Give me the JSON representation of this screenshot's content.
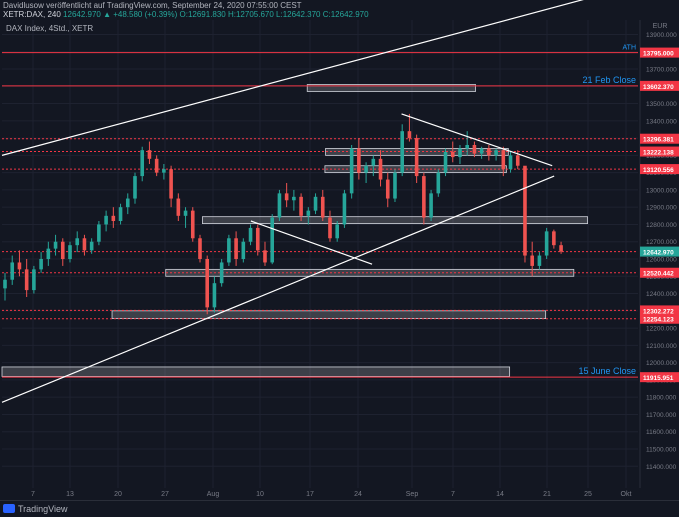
{
  "header": {
    "line1": "Davidlusow veröffentlicht auf TradingView.com, September 24, 2020 07:55:00 CEST",
    "line2_symbol": "XETR:DAX, 240",
    "line2_ohlc": "12642.970 ▲ +48.580 (+0.39%) O:12691.830 H:12705.670 L:12642.370 C:12642.970",
    "chart_label": "DAX Index, 4Std., XETR"
  },
  "footer": {
    "brand": "TradingView"
  },
  "colors": {
    "background": "#131722",
    "bullish": "#26a69a",
    "bearish": "#ef5350",
    "level_line": "#f23645",
    "annotation_blue": "#2196f3",
    "trendline": "#ffffff"
  },
  "chart_data": {
    "type": "candlestick",
    "title": "DAX Index, 4Std., XETR",
    "currency": "EUR",
    "ylim": [
      11300,
      14000
    ],
    "y_ticks": [
      11400,
      11500,
      11600,
      11700,
      11800,
      11900,
      12000,
      12100,
      12200,
      12300,
      12400,
      12500,
      12600,
      12700,
      12800,
      12900,
      13000,
      13100,
      13200,
      13300,
      13400,
      13500,
      13600,
      13700,
      13800,
      13900
    ],
    "x_ticks": [
      "7",
      "13",
      "20",
      "27",
      "Aug",
      "10",
      "17",
      "24",
      "Sep",
      "7",
      "14",
      "21",
      "25",
      "Okt"
    ],
    "last_price": 12642.97,
    "level_labels": [
      {
        "value": "13795.000",
        "price": 13795.0,
        "note": "ATH"
      },
      {
        "value": "13602.370",
        "price": 13602.37,
        "note": "21 Feb Close"
      },
      {
        "value": "13296.381",
        "price": 13296.381
      },
      {
        "value": "13222.138",
        "price": 13222.138
      },
      {
        "value": "13120.556",
        "price": 13120.556
      },
      {
        "value": "12642.970",
        "price": 12642.97
      },
      {
        "value": "12520.442",
        "price": 12520.442
      },
      {
        "value": "12302.272",
        "price": 12302.272
      },
      {
        "value": "12254.123",
        "price": 12254.123
      },
      {
        "value": "11915.951",
        "price": 11915.951,
        "note": "15 June Close"
      }
    ],
    "annotations": [
      "ATH",
      "21 Feb Close",
      "15 June Close"
    ],
    "zones": [
      {
        "low": 13570,
        "high": 13610,
        "from_day": 46.6,
        "to_day": 72.3
      },
      {
        "low": 13200,
        "high": 13240,
        "from_day": 49.4,
        "to_day": 77.3
      },
      {
        "low": 13100,
        "high": 13140,
        "from_day": 49.3,
        "to_day": 77.0
      },
      {
        "low": 12805,
        "high": 12845,
        "from_day": 30.6,
        "to_day": 89.4
      },
      {
        "low": 12500,
        "high": 12540,
        "from_day": 25.0,
        "to_day": 87.3
      },
      {
        "low": 12255,
        "high": 12300,
        "from_day": 16.8,
        "to_day": 83.0
      },
      {
        "low": 11920,
        "high": 11975,
        "from_day": 0,
        "to_day": 77.5
      }
    ],
    "trendlines": [
      {
        "from": [
          0,
          13200
        ],
        "to": [
          90.5,
          14120
        ]
      },
      {
        "from": [
          0,
          11770
        ],
        "to": [
          84.3,
          13080
        ]
      },
      {
        "from": [
          61.0,
          13440
        ],
        "to": [
          84.0,
          13140
        ]
      },
      {
        "from": [
          38.0,
          12820
        ],
        "to": [
          56.5,
          12570
        ]
      }
    ],
    "candles": [
      [
        12430,
        12520,
        12360,
        12480
      ],
      [
        12480,
        12620,
        12450,
        12580
      ],
      [
        12580,
        12650,
        12500,
        12540
      ],
      [
        12540,
        12600,
        12380,
        12420
      ],
      [
        12420,
        12560,
        12400,
        12540
      ],
      [
        12540,
        12640,
        12520,
        12600
      ],
      [
        12600,
        12700,
        12560,
        12660
      ],
      [
        12660,
        12740,
        12620,
        12700
      ],
      [
        12700,
        12720,
        12560,
        12600
      ],
      [
        12600,
        12700,
        12580,
        12680
      ],
      [
        12680,
        12760,
        12640,
        12720
      ],
      [
        12720,
        12740,
        12620,
        12650
      ],
      [
        12650,
        12720,
        12630,
        12700
      ],
      [
        12700,
        12820,
        12680,
        12800
      ],
      [
        12800,
        12880,
        12760,
        12850
      ],
      [
        12850,
        12900,
        12780,
        12820
      ],
      [
        12820,
        12920,
        12800,
        12900
      ],
      [
        12900,
        12980,
        12860,
        12950
      ],
      [
        12950,
        13100,
        12920,
        13080
      ],
      [
        13080,
        13250,
        13050,
        13230
      ],
      [
        13230,
        13280,
        13150,
        13180
      ],
      [
        13180,
        13200,
        13080,
        13100
      ],
      [
        13100,
        13150,
        13060,
        13120
      ],
      [
        13120,
        13140,
        12900,
        12950
      ],
      [
        12950,
        12980,
        12820,
        12850
      ],
      [
        12850,
        12900,
        12780,
        12880
      ],
      [
        12880,
        12900,
        12700,
        12720
      ],
      [
        12720,
        12740,
        12580,
        12600
      ],
      [
        12600,
        12620,
        12280,
        12320
      ],
      [
        12320,
        12500,
        12290,
        12460
      ],
      [
        12460,
        12600,
        12440,
        12580
      ],
      [
        12580,
        12740,
        12560,
        12720
      ],
      [
        12720,
        12760,
        12560,
        12600
      ],
      [
        12600,
        12720,
        12580,
        12700
      ],
      [
        12700,
        12800,
        12680,
        12780
      ],
      [
        12780,
        12800,
        12620,
        12650
      ],
      [
        12650,
        12700,
        12560,
        12580
      ],
      [
        12580,
        12860,
        12570,
        12840
      ],
      [
        12840,
        13000,
        12820,
        12980
      ],
      [
        12980,
        13040,
        12900,
        12940
      ],
      [
        12940,
        13000,
        12880,
        12960
      ],
      [
        12960,
        12980,
        12820,
        12850
      ],
      [
        12850,
        12900,
        12800,
        12880
      ],
      [
        12880,
        12980,
        12860,
        12960
      ],
      [
        12960,
        13000,
        12820,
        12840
      ],
      [
        12840,
        12880,
        12700,
        12720
      ],
      [
        12720,
        12820,
        12700,
        12800
      ],
      [
        12800,
        13000,
        12780,
        12980
      ],
      [
        12980,
        13260,
        12950,
        13240
      ],
      [
        13240,
        13300,
        13060,
        13100
      ],
      [
        13100,
        13160,
        13040,
        13140
      ],
      [
        13140,
        13200,
        13080,
        13180
      ],
      [
        13180,
        13230,
        13020,
        13060
      ],
      [
        13060,
        13100,
        12900,
        12950
      ],
      [
        12950,
        13120,
        12930,
        13100
      ],
      [
        13100,
        13380,
        13080,
        13340
      ],
      [
        13340,
        13440,
        13280,
        13300
      ],
      [
        13300,
        13320,
        13040,
        13080
      ],
      [
        13080,
        13100,
        12800,
        12840
      ],
      [
        12840,
        13000,
        12820,
        12980
      ],
      [
        12980,
        13120,
        12960,
        13100
      ],
      [
        13100,
        13240,
        13080,
        13220
      ],
      [
        13220,
        13280,
        13160,
        13190
      ],
      [
        13190,
        13260,
        13150,
        13240
      ],
      [
        13240,
        13340,
        13200,
        13260
      ],
      [
        13260,
        13280,
        13190,
        13210
      ],
      [
        13210,
        13250,
        13180,
        13240
      ],
      [
        13240,
        13260,
        13170,
        13200
      ],
      [
        13200,
        13240,
        13170,
        13230
      ],
      [
        13230,
        13250,
        13080,
        13120
      ],
      [
        13120,
        13220,
        13100,
        13200
      ],
      [
        13200,
        13230,
        13120,
        13140
      ],
      [
        13140,
        13000,
        12580,
        12620
      ],
      [
        12620,
        12700,
        12500,
        12560
      ],
      [
        12560,
        12640,
        12540,
        12620
      ],
      [
        12620,
        12780,
        12600,
        12760
      ],
      [
        12760,
        12770,
        12660,
        12680
      ],
      [
        12680,
        12700,
        12630,
        12643
      ]
    ]
  }
}
